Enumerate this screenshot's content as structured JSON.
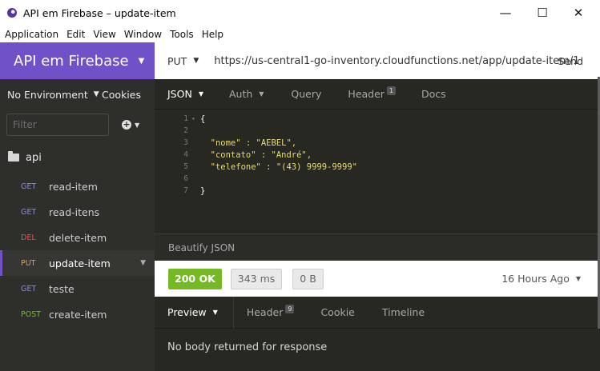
{
  "window": {
    "title": "API em Firebase – update-item",
    "controls": {
      "minimize": "—",
      "maximize": "☐",
      "close": "✕"
    }
  },
  "menu": [
    "Application",
    "Edit",
    "View",
    "Window",
    "Tools",
    "Help"
  ],
  "sidebar": {
    "workspace": "API em Firebase",
    "environment": "No Environment",
    "cookies": "Cookies",
    "filter_placeholder": "Filter",
    "folder": "api",
    "requests": [
      {
        "method": "GET",
        "name": "read-item",
        "color": "#8a87e8"
      },
      {
        "method": "GET",
        "name": "read-itens",
        "color": "#8a87e8"
      },
      {
        "method": "DEL",
        "name": "delete-item",
        "color": "#e5524c"
      },
      {
        "method": "PUT",
        "name": "update-item",
        "color": "#e8a33b",
        "active": true
      },
      {
        "method": "GET",
        "name": "teste",
        "color": "#8a87e8"
      },
      {
        "method": "POST",
        "name": "create-item",
        "color": "#75ba24"
      }
    ]
  },
  "request": {
    "method": "PUT",
    "url": "https://us-central1-go-inventory.cloudfunctions.net/app/update-item/1",
    "send": "Send",
    "tabs": {
      "json": "JSON",
      "auth": "Auth",
      "query": "Query",
      "header": "Header",
      "header_count": "1",
      "docs": "Docs"
    },
    "body_lines": [
      "{",
      "",
      "  \"nome\" : \"AEBEL\",",
      "  \"contato\" : \"André\",",
      "  \"telefone\" : \"(43) 9999-9999\"",
      "",
      "}"
    ],
    "line_numbers": [
      "1",
      "2",
      "3",
      "4",
      "5",
      "6",
      "7"
    ],
    "beautify": "Beautify JSON"
  },
  "response": {
    "status": "200 OK",
    "time": "343 ms",
    "size": "0 B",
    "time_ago": "16 Hours Ago",
    "tabs": {
      "preview": "Preview",
      "header": "Header",
      "header_count": "9",
      "cookie": "Cookie",
      "timeline": "Timeline"
    },
    "body": "No body returned for response"
  },
  "colors": {
    "accent": "#7151c8",
    "ok": "#75ba24",
    "editor_bg": "#272822",
    "sidebar_bg": "#2e2f2b"
  }
}
